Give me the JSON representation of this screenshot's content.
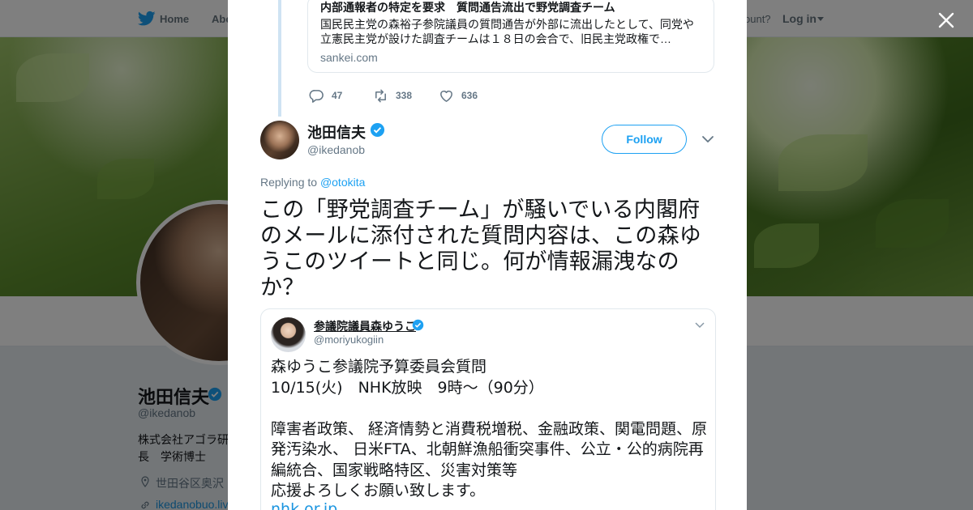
{
  "nav": {
    "home": "Home",
    "about": "Abo",
    "account_prompt": "ccount?",
    "login": "Log in"
  },
  "profile": {
    "name": "池田信夫",
    "handle": "@ikedanob",
    "bio": "株式会社アゴラ研 長　学術博士",
    "location": "世田谷区奥沢",
    "link": "ikedanobuo.liv"
  },
  "thread": {
    "card": {
      "title": "内部通報者の特定を要求　質問通告流出で野党調査チーム",
      "description": "国民民主党の森裕子参院議員の質問通告が外部に流出したとして、同党や立憲民主党が設けた調査チームは１８日の会合で、旧民主党政権で…",
      "domain": "sankei.com"
    },
    "actions": {
      "replies": "47",
      "retweets": "338",
      "likes": "636"
    }
  },
  "tweet": {
    "author_name": "池田信夫",
    "author_handle": "@ikedanob",
    "follow_label": "Follow",
    "replying_prefix": "Replying to",
    "replying_to": "@otokita",
    "text": "この「野党調査チーム」が騒いでいる内閣府のメールに添付された質問内容は、この森ゆうこのツイートと同じ。何が情報漏洩なのか？"
  },
  "embedded": {
    "name": "参議院議員森ゆうこ",
    "handle": "@moriyukogiin",
    "lines": [
      "森ゆうこ参議院予算委員会質問",
      "10/15(火)　NHK放映　9時～（90分）",
      "",
      "障害者政策、 経済情勢と消費税増税、金融政策、関電問題、原発汚染水、 日米FTA、北朝鮮漁船衝突事件、公立・公的病院再編統合、国家戦略特区、災害対策等",
      "応援よろしくお願い致します。"
    ],
    "link": "nhk.or.jp"
  },
  "colors": {
    "accent": "#1da1f2",
    "verified": "#1da1f2",
    "thread_line": "#cfe3f3",
    "overlay": "rgba(0,0,0,0.5)"
  },
  "icons": [
    "twitter-bird-icon",
    "close-icon",
    "reply-icon",
    "retweet-icon",
    "like-icon",
    "verified-badge-icon",
    "chevron-down-icon",
    "location-pin-icon",
    "link-icon"
  ]
}
